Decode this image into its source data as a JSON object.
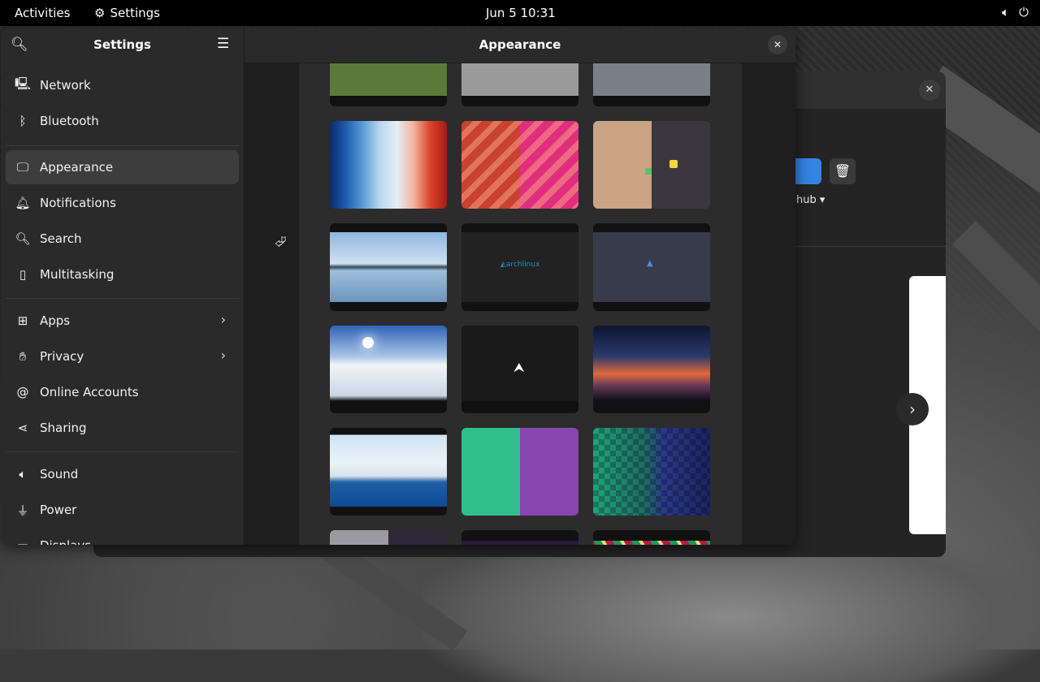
{
  "topbar": {
    "activities": "Activities",
    "app_name": "Settings",
    "clock": "Jun 5  10:31"
  },
  "settings": {
    "sidebar_title": "Settings",
    "content_title": "Appearance",
    "nav_items": [
      {
        "label": "Network",
        "icon": "network-icon"
      },
      {
        "label": "Bluetooth",
        "icon": "bluetooth-icon"
      },
      {
        "label": "Appearance",
        "icon": "appearance-icon",
        "active": true
      },
      {
        "label": "Notifications",
        "icon": "bell-icon"
      },
      {
        "label": "Search",
        "icon": "search-icon"
      },
      {
        "label": "Multitasking",
        "icon": "multitasking-icon"
      },
      {
        "label": "Apps",
        "icon": "apps-icon"
      },
      {
        "label": "Privacy",
        "icon": "privacy-hand-icon"
      },
      {
        "label": "Online Accounts",
        "icon": "at-icon"
      },
      {
        "label": "Sharing",
        "icon": "share-icon"
      },
      {
        "label": "Sound",
        "icon": "speaker-icon"
      },
      {
        "label": "Power",
        "icon": "power-plug-icon"
      },
      {
        "label": "Displays",
        "icon": "display-icon"
      }
    ]
  },
  "wallpaper_logos": {
    "arch_text": "archlinux"
  },
  "background_window": {
    "dropdown_text": "hub"
  },
  "colors": {
    "accent": "#3584e4",
    "window_bg": "#242424",
    "sidebar_bg": "#2a2a2a"
  }
}
